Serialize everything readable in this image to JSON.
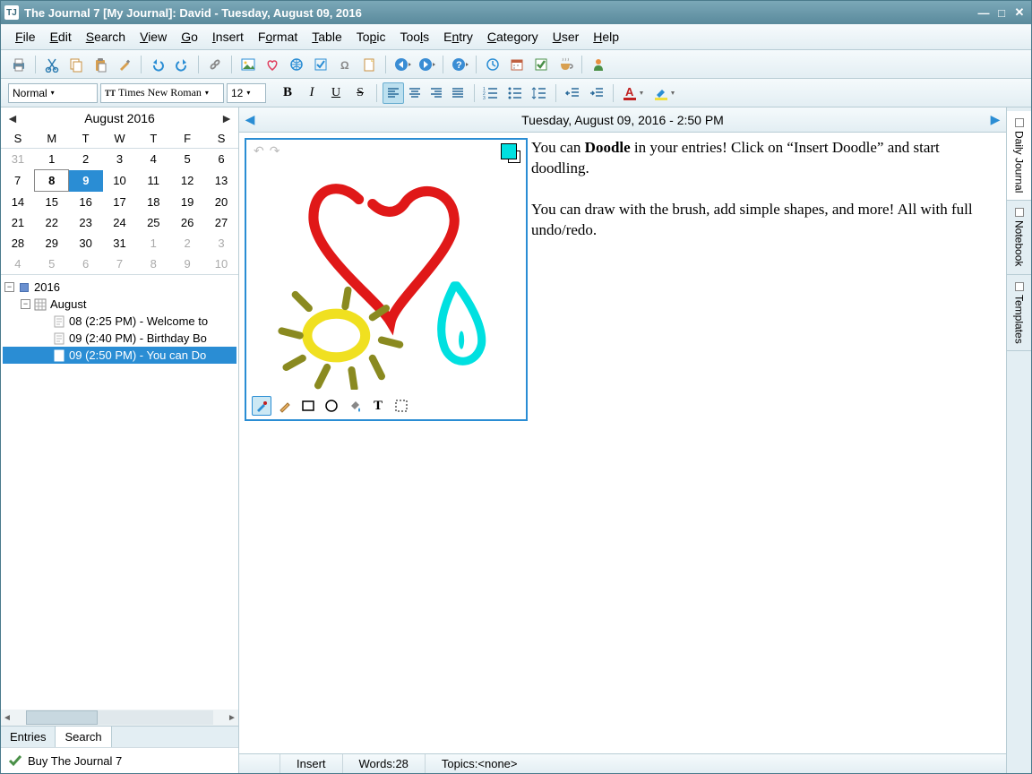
{
  "window": {
    "title": "The Journal 7 [My Journal]: David - Tuesday, August 09, 2016"
  },
  "menu": [
    "File",
    "Edit",
    "Search",
    "View",
    "Go",
    "Insert",
    "Format",
    "Table",
    "Topic",
    "Tools",
    "Entry",
    "Category",
    "User",
    "Help"
  ],
  "format": {
    "style": "Normal",
    "font": "Times New Roman",
    "size": "12"
  },
  "calendar": {
    "month": "August 2016",
    "dows": [
      "S",
      "M",
      "T",
      "W",
      "T",
      "F",
      "S"
    ],
    "rows": [
      [
        {
          "d": "31",
          "o": true
        },
        {
          "d": "1"
        },
        {
          "d": "2"
        },
        {
          "d": "3"
        },
        {
          "d": "4"
        },
        {
          "d": "5"
        },
        {
          "d": "6"
        }
      ],
      [
        {
          "d": "7"
        },
        {
          "d": "8",
          "box": true,
          "b": true
        },
        {
          "d": "9",
          "sel": true,
          "b": true
        },
        {
          "d": "10"
        },
        {
          "d": "11"
        },
        {
          "d": "12"
        },
        {
          "d": "13"
        }
      ],
      [
        {
          "d": "14"
        },
        {
          "d": "15"
        },
        {
          "d": "16"
        },
        {
          "d": "17"
        },
        {
          "d": "18"
        },
        {
          "d": "19"
        },
        {
          "d": "20"
        }
      ],
      [
        {
          "d": "21"
        },
        {
          "d": "22"
        },
        {
          "d": "23"
        },
        {
          "d": "24"
        },
        {
          "d": "25"
        },
        {
          "d": "26"
        },
        {
          "d": "27"
        }
      ],
      [
        {
          "d": "28"
        },
        {
          "d": "29"
        },
        {
          "d": "30"
        },
        {
          "d": "31"
        },
        {
          "d": "1",
          "o": true
        },
        {
          "d": "2",
          "o": true
        },
        {
          "d": "3",
          "o": true
        }
      ],
      [
        {
          "d": "4",
          "o": true
        },
        {
          "d": "5",
          "o": true
        },
        {
          "d": "6",
          "o": true
        },
        {
          "d": "7",
          "o": true
        },
        {
          "d": "8",
          "o": true
        },
        {
          "d": "9",
          "o": true
        },
        {
          "d": "10",
          "o": true
        }
      ]
    ]
  },
  "tree": {
    "year": "2016",
    "month": "August",
    "entries": [
      {
        "label": "08 (2:25 PM) - Welcome to"
      },
      {
        "label": "09 (2:40 PM) - Birthday Bo"
      },
      {
        "label": "09 (2:50 PM) - You can Do",
        "sel": true
      }
    ]
  },
  "side_tabs": {
    "entries": "Entries",
    "search": "Search",
    "active": "Search"
  },
  "buy": {
    "label": "Buy The Journal 7"
  },
  "entry": {
    "title": "Tuesday, August 09, 2016 - 2:50 PM",
    "para1a": "You can ",
    "para1b": "Doodle",
    "para1c": " in your entries! Click on “Insert Doodle” and start doodling.",
    "para2": "You can draw with the brush, add simple shapes, and more! All with full undo/redo."
  },
  "right_tabs": [
    "Daily Journal",
    "Notebook",
    "Templates"
  ],
  "status": {
    "mode": "Insert",
    "words_label": "Words: ",
    "words": "28",
    "topics_label": "Topics: ",
    "topics": "<none>"
  },
  "colors": {
    "accent": "#2a8dd4",
    "brush": "#00e0e0"
  }
}
